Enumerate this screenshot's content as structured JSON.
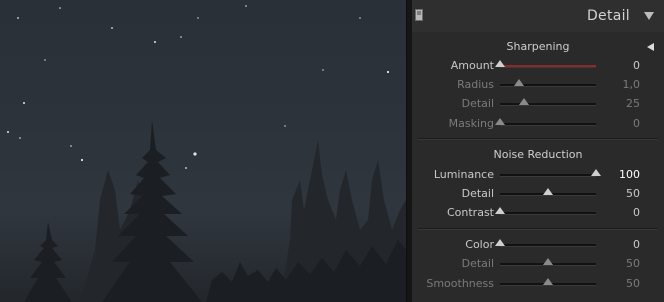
{
  "panel": {
    "title": "Detail",
    "sharpening": {
      "title": "Sharpening",
      "rows": [
        {
          "label": "Amount",
          "value": "0",
          "level": 0.0,
          "dim": false
        },
        {
          "label": "Radius",
          "value": "1,0",
          "level": 0.2,
          "dim": true
        },
        {
          "label": "Detail",
          "value": "25",
          "level": 0.25,
          "dim": true
        },
        {
          "label": "Masking",
          "value": "0",
          "level": 0.0,
          "dim": true
        }
      ]
    },
    "noise": {
      "title": "Noise Reduction",
      "rows": [
        {
          "label": "Luminance",
          "value": "100",
          "level": 1.0,
          "dim": false
        },
        {
          "label": "Detail",
          "value": "50",
          "level": 0.5,
          "dim": false
        },
        {
          "label": "Contrast",
          "value": "0",
          "level": 0.0,
          "dim": false
        }
      ],
      "color_rows": [
        {
          "label": "Color",
          "value": "0",
          "level": 0.0,
          "dim": false
        },
        {
          "label": "Detail",
          "value": "50",
          "level": 0.5,
          "dim": true
        },
        {
          "label": "Smoothness",
          "value": "50",
          "level": 0.5,
          "dim": true
        }
      ]
    }
  },
  "icons": {
    "header_toggle": "panel-toggle-icon",
    "header_collapse": "triangle-down-icon",
    "sharpening_collapse": "triangle-left-icon"
  },
  "colors": {
    "amount_fill": "#8a2a2a"
  }
}
